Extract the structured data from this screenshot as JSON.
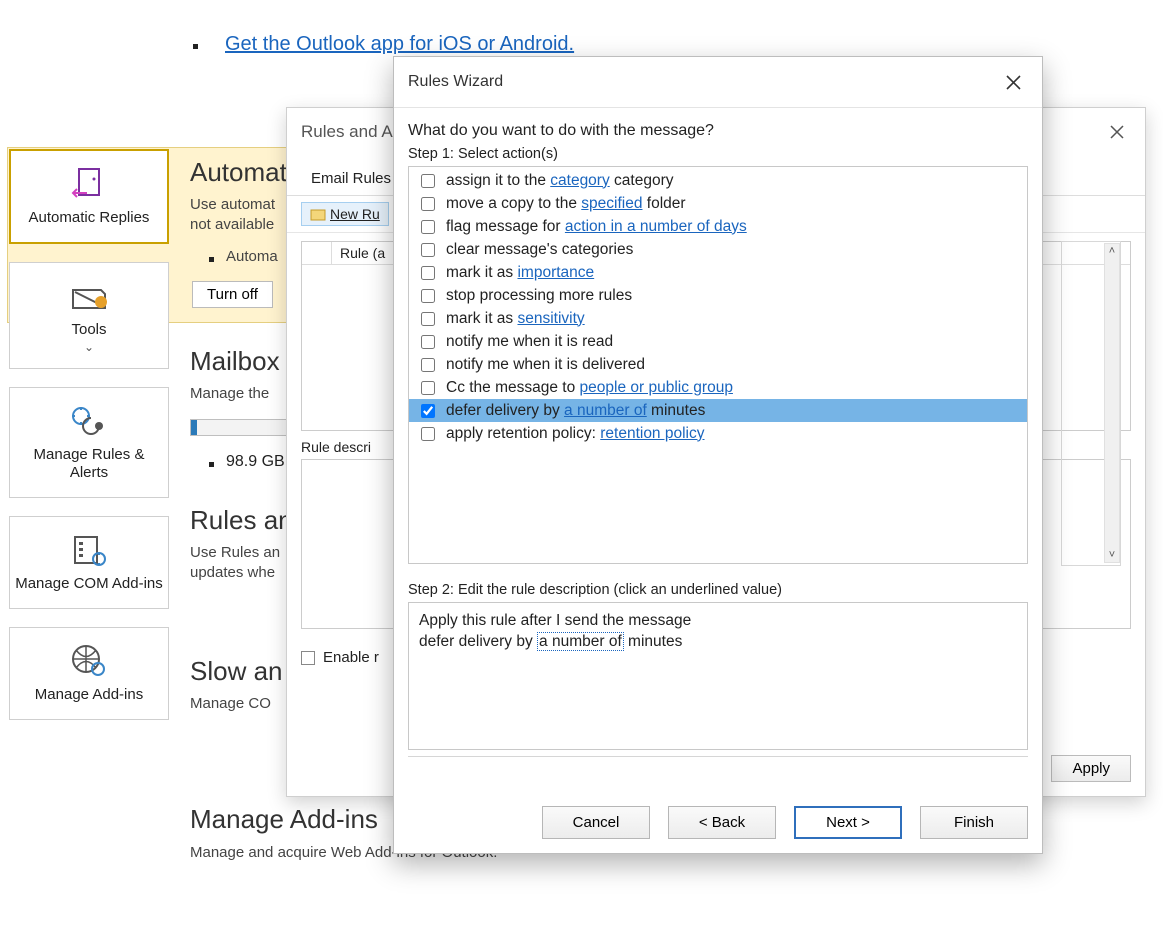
{
  "top_link": "Get the Outlook app for iOS or Android.",
  "yellow": {
    "automatic_replies": "Automatic Replies",
    "tools": "Tools",
    "manage_rules": "Manage Rules & Alerts",
    "manage_com": "Manage COM Add-ins",
    "manage_addins": "Manage Add-ins"
  },
  "sections": {
    "auto": {
      "head": "Automat",
      "desc1": "Use automat",
      "desc2": "not available",
      "bullet": "Automa",
      "turn": "Turn off"
    },
    "mailbox": {
      "head": "Mailbox",
      "desc": "Manage the",
      "gb": "98.9 GB"
    },
    "rules": {
      "head": "Rules an",
      "d1": "Use Rules an",
      "d2": "updates whe"
    },
    "slow": {
      "head": "Slow an",
      "d1": "Manage CO"
    },
    "addins": {
      "head": "Manage Add-ins",
      "d1": "Manage and acquire Web Add-ins for Outlook."
    }
  },
  "back": {
    "title": "Rules and A",
    "tab": "Email Rules",
    "new_rule": "New Ru",
    "col_rule": "Rule (a",
    "desc_label": "Rule descri",
    "enable": "Enable r",
    "apply": "Apply"
  },
  "wizard": {
    "title": "Rules Wizard",
    "question": "What do you want to do with the message?",
    "step1": "Step 1: Select action(s)",
    "step2": "Step 2: Edit the rule description (click an underlined value)",
    "actions": [
      {
        "pre": "assign it to the ",
        "link": "category",
        "post": " category",
        "checked": false
      },
      {
        "pre": "move a copy to the ",
        "link": "specified",
        "post": " folder",
        "checked": false
      },
      {
        "pre": "flag message for ",
        "link": "action in a number of days",
        "post": "",
        "checked": false
      },
      {
        "pre": "clear message's categories",
        "link": "",
        "post": "",
        "checked": false
      },
      {
        "pre": "mark it as ",
        "link": "importance",
        "post": "",
        "checked": false
      },
      {
        "pre": "stop processing more rules",
        "link": "",
        "post": "",
        "checked": false
      },
      {
        "pre": "mark it as ",
        "link": "sensitivity",
        "post": "",
        "checked": false
      },
      {
        "pre": "notify me when it is read",
        "link": "",
        "post": "",
        "checked": false
      },
      {
        "pre": "notify me when it is delivered",
        "link": "",
        "post": "",
        "checked": false
      },
      {
        "pre": "Cc the message to ",
        "link": "people or public group",
        "post": "",
        "checked": false
      },
      {
        "pre": "defer delivery by ",
        "link": "a number of",
        "post": " minutes",
        "checked": true,
        "selected": true
      },
      {
        "pre": "apply retention policy: ",
        "link": "retention policy",
        "post": "",
        "checked": false
      }
    ],
    "desc_line1": "Apply this rule after I send the message",
    "desc_pre": "defer delivery by ",
    "desc_link": "a number of",
    "desc_post": " minutes",
    "buttons": {
      "cancel": "Cancel",
      "back": "<  Back",
      "next": "Next  >",
      "finish": "Finish"
    }
  }
}
